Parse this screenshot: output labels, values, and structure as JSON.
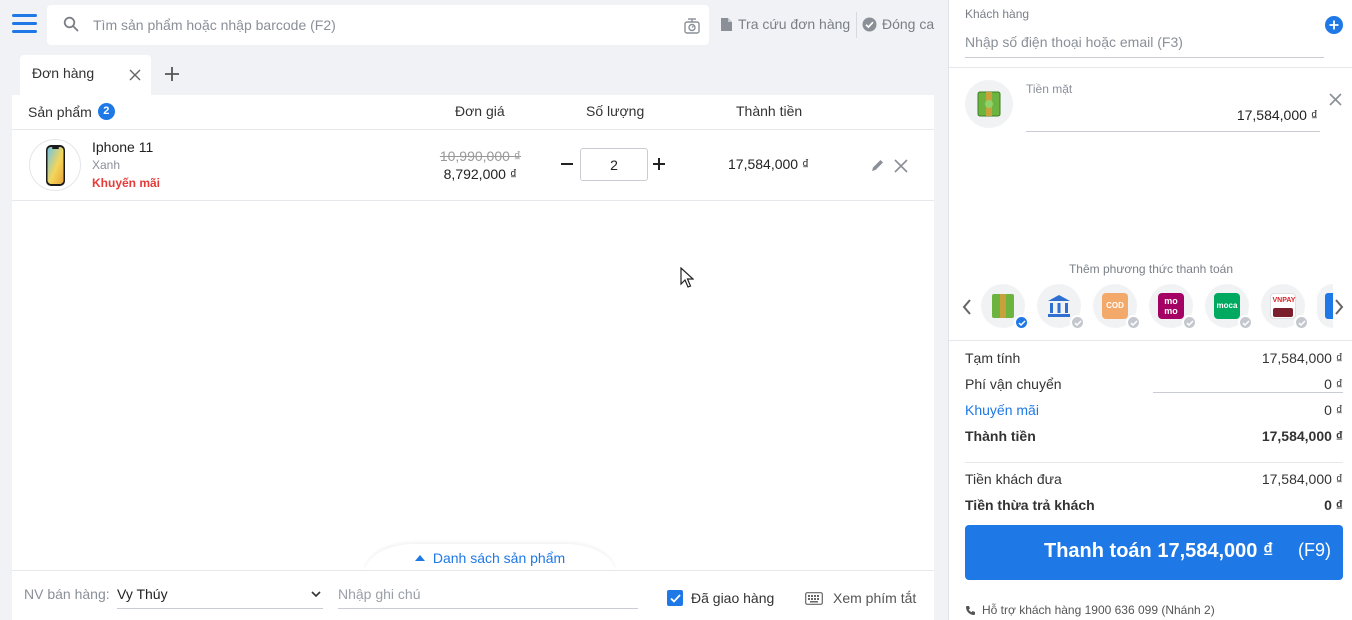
{
  "search": {
    "placeholder": "Tìm sản phẩm hoặc nhập barcode (F2)"
  },
  "toolbar": {
    "lookup_label": "Tra cứu đơn hàng",
    "close_shift_label": "Đóng ca"
  },
  "tabs": [
    {
      "label": "Đơn hàng",
      "active": true
    }
  ],
  "table": {
    "headers": {
      "product": "Sản phẩm",
      "product_count": "2",
      "price": "Đơn giá",
      "qty": "Số lượng",
      "total": "Thành tiền"
    },
    "rows": [
      {
        "name": "Iphone 11",
        "variant": "Xanh",
        "promo": "Khuyến mãi",
        "old_price": "10,990,000 ₫",
        "price": "8,792,000 ₫",
        "qty": "2",
        "total": "17,584,000 ₫"
      }
    ]
  },
  "product_list_toggle": "Danh sách sản phẩm",
  "bottom": {
    "staff_label": "NV bán hàng:",
    "staff_value": "Vy Thúy",
    "note_placeholder": "Nhập ghi chú",
    "delivered_label": "Đã giao hàng",
    "delivered_checked": true,
    "shortcuts_label": "Xem phím tắt"
  },
  "customer": {
    "label": "Khách hàng",
    "placeholder": "Nhập số điện thoại hoặc email (F3)"
  },
  "payment": {
    "cash_label": "Tiền mặt",
    "cash_value": "17,584,000 ₫",
    "add_method_label": "Thêm phương thức thanh toán",
    "methods": [
      {
        "icon": "cash-icon",
        "selected": true
      },
      {
        "icon": "bank-icon",
        "selected": false
      },
      {
        "icon": "cod-icon",
        "label": "COD",
        "selected": false
      },
      {
        "icon": "momo-icon",
        "label": "mo mo",
        "selected": false
      },
      {
        "icon": "moca-icon",
        "label": "moca",
        "selected": false
      },
      {
        "icon": "vnpay-icon",
        "label": "VNPAY",
        "selected": false
      }
    ]
  },
  "summary": {
    "subtotal_label": "Tạm tính",
    "subtotal_value": "17,584,000 ₫",
    "shipping_label": "Phí vận chuyển",
    "shipping_value": "0 ₫",
    "discount_label": "Khuyến mãi",
    "discount_value": "0 ₫",
    "total_label": "Thành tiền",
    "total_value": "17,584,000 ₫",
    "given_label": "Tiền khách đưa",
    "given_value": "17,584,000 ₫",
    "change_label": "Tiền thừa trả khách",
    "change_value": "0 ₫"
  },
  "pay_button": {
    "label": "Thanh toán 17,584,000 ₫",
    "shortcut": "(F9)"
  },
  "support": "Hỗ trợ khách hàng 1900 636 099 (Nhánh 2)",
  "colors": {
    "accent": "#1e78e6",
    "promo": "#e63b3b",
    "background": "#f1f2f5"
  }
}
